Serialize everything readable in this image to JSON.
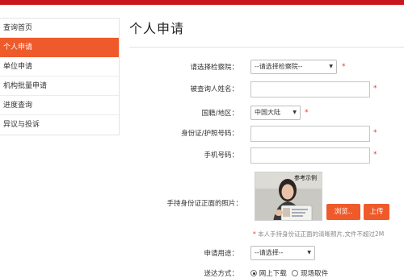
{
  "sidebar": {
    "items": [
      {
        "label": "查询首页"
      },
      {
        "label": "个人申请"
      },
      {
        "label": "单位申请"
      },
      {
        "label": "机构批量申请"
      },
      {
        "label": "进度查询"
      },
      {
        "label": "异议与投诉"
      }
    ],
    "active_index": 1
  },
  "page": {
    "title": "个人申请"
  },
  "form": {
    "procuratorate": {
      "label": "请选择检察院：",
      "value": "--请选择检察院--"
    },
    "name": {
      "label": "被查询人姓名：",
      "value": ""
    },
    "nationality": {
      "label": "国籍/地区：",
      "value": "中国大陆"
    },
    "id_number": {
      "label": "身份证/护照号码：",
      "value": ""
    },
    "phone": {
      "label": "手机号码：",
      "value": ""
    },
    "photo": {
      "label": "手持身份证正面的照片：",
      "sample_caption": "参考示例",
      "browse_label": "浏览..",
      "upload_label": "上传",
      "note": "本人手持身份证正面的清晰照片,文件不超过2M"
    },
    "purpose": {
      "label": "申请用途：",
      "value": "--请选择--"
    },
    "delivery": {
      "label": "送达方式：",
      "options": [
        {
          "label": "网上下载",
          "selected": true
        },
        {
          "label": "现场取件",
          "selected": false
        }
      ]
    },
    "required_mark": "*"
  },
  "colors": {
    "brand_red": "#c8161d",
    "accent_orange": "#ef5a2b",
    "required": "#e23b2d"
  }
}
